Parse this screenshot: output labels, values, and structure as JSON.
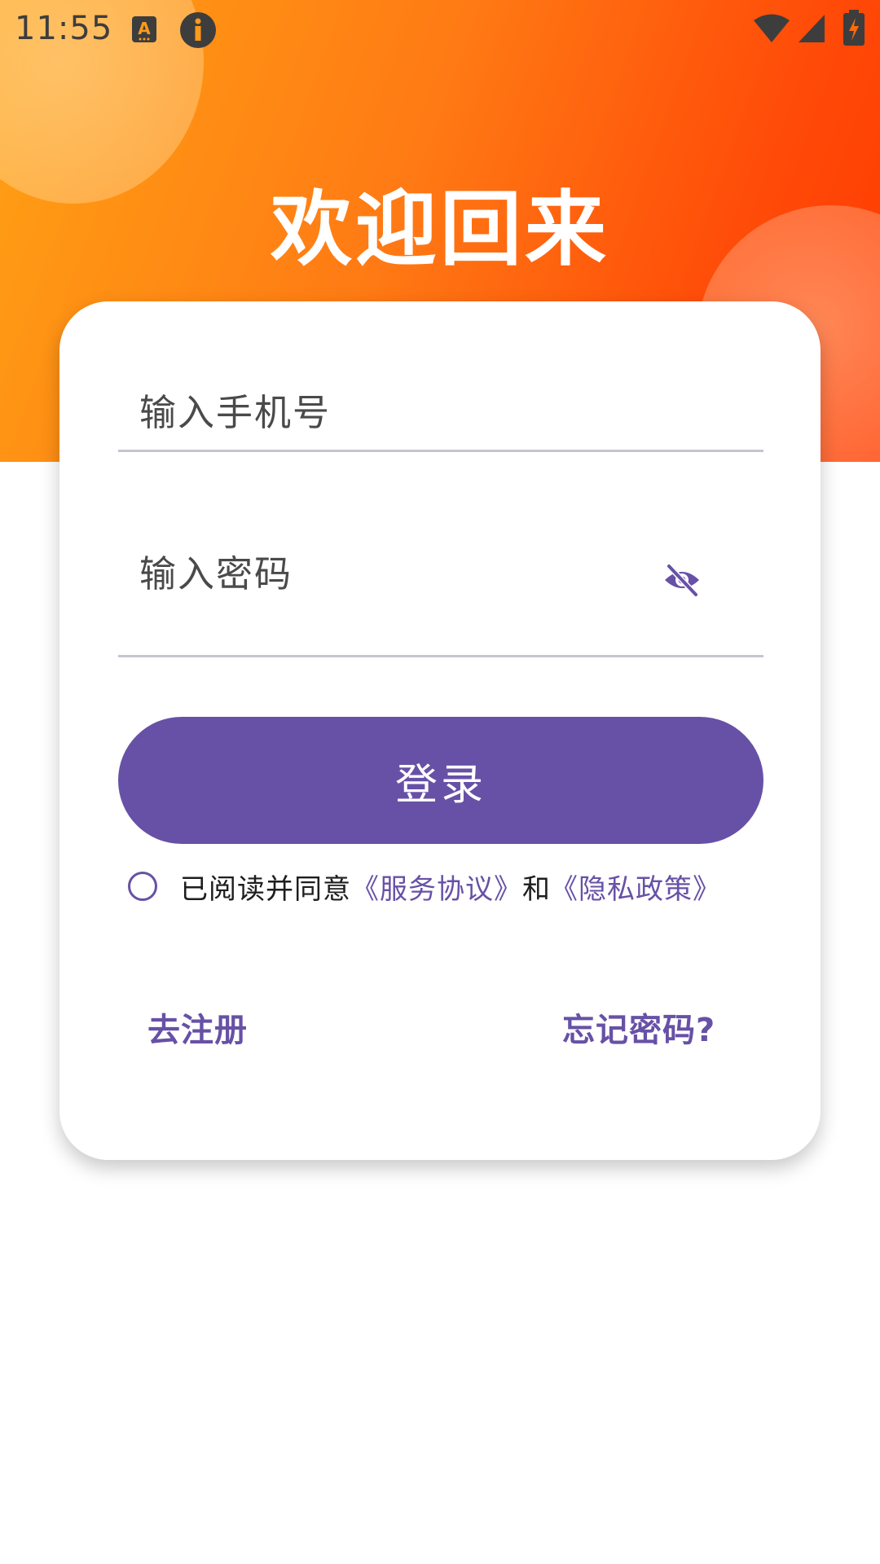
{
  "status_bar": {
    "time": "11:55",
    "icons": [
      "keyboard-a-icon",
      "info-icon",
      "wifi-icon",
      "cell-signal-icon",
      "battery-charging-icon"
    ]
  },
  "header": {
    "title": "欢迎回来"
  },
  "form": {
    "phone_placeholder": "输入手机号",
    "password_placeholder": "输入密码",
    "password_toggle_icon": "eye-off-icon",
    "login_label": "登录"
  },
  "agreement": {
    "prefix": "已阅读并同意",
    "service_link": "《服务协议》",
    "and": "和",
    "privacy_link": "《隐私政策》",
    "checked": false
  },
  "links": {
    "register": "去注册",
    "forgot": "忘记密码?"
  },
  "colors": {
    "accent": "#6751a6",
    "header_start": "#ffa114",
    "header_end": "#ff3a00",
    "background": "#ffffff"
  }
}
